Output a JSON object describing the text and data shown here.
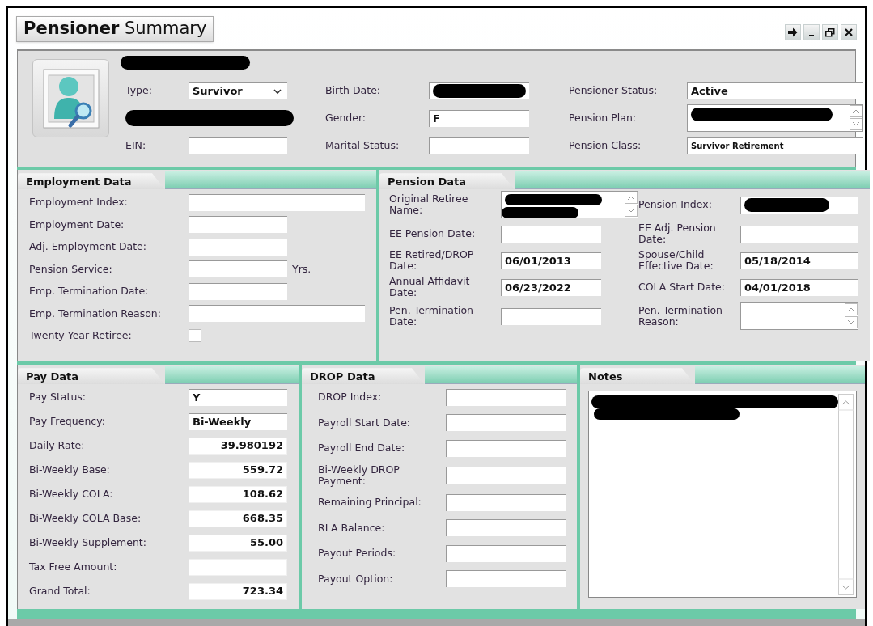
{
  "window": {
    "title": "**Pensioner** Summary",
    "controls": [
      {
        "kind": "pin"
      },
      {
        "kind": "minimize"
      },
      {
        "kind": "restore"
      },
      {
        "kind": "close"
      }
    ]
  },
  "header": {
    "name": {
      "redacted": true
    },
    "columns": [
      [
        {
          "kind": "select",
          "label": "Type:",
          "value": "Survivor",
          "redacted": false
        },
        {
          "kind": "redacted",
          "redacted": true
        },
        {
          "kind": "text",
          "label": "EIN:",
          "redacted": false
        }
      ],
      [
        {
          "kind": "text",
          "label": "Birth Date:",
          "redacted": true
        },
        {
          "kind": "text",
          "label": "Gender:",
          "value": "F",
          "redacted": false
        },
        {
          "kind": "text",
          "label": "Marital Status:",
          "redacted": false
        }
      ],
      [
        {
          "kind": "text",
          "label": "Pensioner Status:",
          "value": "Active",
          "redacted": false
        },
        {
          "kind": "spin",
          "label": "Pension Plan:",
          "redacted": true
        },
        {
          "kind": "small",
          "label": "Pension Class:",
          "value": "Survivor Retirement",
          "redacted": false
        }
      ]
    ]
  },
  "employment": {
    "title": "Employment Data",
    "fields": [
      {
        "kind": "long",
        "label": "Employment Index:"
      },
      {
        "kind": "text",
        "label": "Employment Date:"
      },
      {
        "kind": "text",
        "label": "Adj. Employment Date:"
      },
      {
        "kind": "text",
        "label": "Pension Service:",
        "unit": "Yrs."
      },
      {
        "kind": "text",
        "label": "Emp. Termination Date:"
      },
      {
        "kind": "long",
        "label": "Emp. Termination Reason:"
      },
      {
        "kind": "checkbox",
        "label": "Twenty Year Retiree:",
        "checked": false
      }
    ]
  },
  "pension": {
    "title": "Pension Data",
    "fields": [
      {
        "kind": "spin",
        "label": "Original Retiree Name:",
        "redacted": true
      },
      {
        "kind": "wide",
        "label": "Pension Index:",
        "redacted": true
      },
      {
        "kind": "text",
        "label": "EE Pension Date:",
        "redacted": false
      },
      {
        "kind": "wide",
        "label": "EE Adj. Pension Date:",
        "redacted": false
      },
      {
        "kind": "text",
        "label": "EE Retired/DROP Date:",
        "value": "06/01/2013",
        "redacted": false
      },
      {
        "kind": "wide",
        "label": "Spouse/Child Effective Date:",
        "value": "05/18/2014",
        "redacted": false
      },
      {
        "kind": "text",
        "label": "Annual Affidavit Date:",
        "value": "06/23/2022",
        "redacted": false
      },
      {
        "kind": "wide",
        "label": "COLA Start Date:",
        "value": "04/01/2018",
        "redacted": false
      },
      {
        "kind": "text",
        "label": "Pen. Termination Date:",
        "redacted": false
      },
      {
        "kind": "spin",
        "label": "Pen. Termination Reason:",
        "redacted": false
      }
    ]
  },
  "pay": {
    "title": "Pay Data",
    "fields": [
      {
        "kind": "text",
        "label": "Pay Status:",
        "value": "Y"
      },
      {
        "kind": "text",
        "label": "Pay Frequency:",
        "value": "Bi-Weekly"
      },
      {
        "kind": "number",
        "label": "Daily Rate:",
        "value": "39.980192"
      },
      {
        "kind": "number",
        "label": "Bi-Weekly Base:",
        "value": "559.72"
      },
      {
        "kind": "number",
        "label": "Bi-Weekly COLA:",
        "value": "108.62"
      },
      {
        "kind": "number",
        "label": "Bi-Weekly COLA Base:",
        "value": "668.35"
      },
      {
        "kind": "number",
        "label": "Bi-Weekly Supplement:",
        "value": "55.00"
      },
      {
        "kind": "number",
        "label": "Tax Free Amount:"
      },
      {
        "kind": "number",
        "label": "Grand Total:",
        "value": "723.34"
      }
    ]
  },
  "drop": {
    "title": "DROP Data",
    "fields": [
      {
        "label": "DROP Index:"
      },
      {
        "label": "Payroll Start Date:"
      },
      {
        "label": "Payroll End Date:"
      },
      {
        "label": "Bi-Weekly DROP Payment:"
      },
      {
        "label": "Remaining Principal:"
      },
      {
        "label": "RLA Balance:"
      },
      {
        "label": "Payout Periods:"
      },
      {
        "label": "Payout Option:"
      }
    ]
  },
  "notes": {
    "title": "Notes",
    "redacted": true
  }
}
